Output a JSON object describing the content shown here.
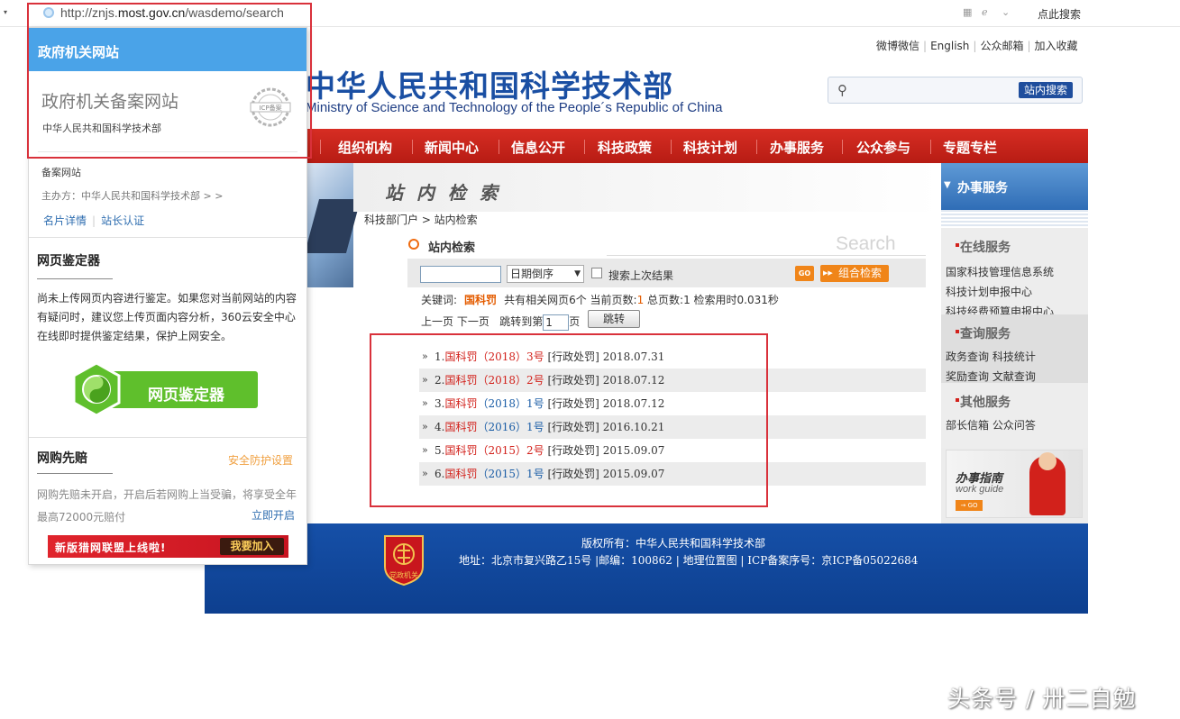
{
  "browser": {
    "url_prefix": "http://znjs.",
    "url_domain": "most.gov.cn",
    "url_path": "/wasdemo/search",
    "search_label": "点此搜索"
  },
  "site": {
    "title": "中华人民共和国科学技术部",
    "subtitle": "Ministry of Science and Technology of the People´s Republic of China",
    "top_links": [
      "微博微信",
      "English",
      "公众邮箱",
      "加入收藏"
    ],
    "search_button": "站内搜索",
    "nav": [
      "组织机构",
      "新闻中心",
      "信息公开",
      "科技政策",
      "科技计划",
      "办事服务",
      "公众参与",
      "专题专栏"
    ],
    "content_title": "站 内 检 索",
    "breadcrumb": "科技部门户 > 站内检索",
    "search_label": "站内检索",
    "search_watermark": "Search",
    "sort_option": "日期倒序",
    "last_result_label": "搜索上次结果",
    "go_label": "GO",
    "combo_label": "组合检索",
    "result_info": {
      "prefix": "关键词:",
      "keyword": "国科罚",
      "pages_text": "共有相关网页6个  当前页数:",
      "current_page": "1",
      "total_text": "总页数:1 检索用时0.031秒"
    },
    "pager": {
      "prev_next": "上一页 下一页",
      "jump_to": "跳转到第",
      "page_value": "1",
      "page_suffix": "页",
      "jump_button": "跳转"
    },
    "results": [
      {
        "num": "1.",
        "code": "国科罚",
        "year": "（2018）",
        "no": "3号",
        "tag": "[行政处罚]",
        "date": "2018.07.31"
      },
      {
        "num": "2.",
        "code": "国科罚",
        "year": "（2018）",
        "no": "2号",
        "tag": "[行政处罚]",
        "date": "2018.07.12"
      },
      {
        "num": "3.",
        "code": "国科罚",
        "year": "（2018）",
        "no": "1号",
        "tag": "[行政处罚]",
        "date": "2018.07.12"
      },
      {
        "num": "4.",
        "code": "国科罚",
        "year": "（2016）",
        "no": "1号",
        "tag": "[行政处罚]",
        "date": "2016.10.21"
      },
      {
        "num": "5.",
        "code": "国科罚",
        "year": "（2015）",
        "no": "2号",
        "tag": "[行政处罚]",
        "date": "2015.09.07"
      },
      {
        "num": "6.",
        "code": "国科罚",
        "year": "（2015）",
        "no": "1号",
        "tag": "[行政处罚]",
        "date": "2015.09.07"
      }
    ],
    "right": {
      "header": "办事服务",
      "online_title": "在线服务",
      "online_items": [
        "国家科技管理信息系统",
        "科技计划申报中心",
        "科技经费预算申报中心"
      ],
      "query_title": "查询服务",
      "query_items": [
        "政务查询 科技统计",
        "奖励查询 文献查询"
      ],
      "other_title": "其他服务",
      "other_items": [
        "部长信箱 公众问答"
      ],
      "guide_title": "办事指南",
      "guide_sub": "work guide",
      "guide_go": "→ GO"
    },
    "footer": {
      "emblem_text": "党政机关",
      "line1": "版权所有：中华人民共和国科学技术部",
      "line2": "地址：北京市复兴路乙15号 |邮编：100862 | 地理位置图 | ICP备案序号：京ICP备05022684"
    }
  },
  "popup": {
    "header": "政府机关网站",
    "icp_title": "政府机关备案网站",
    "icp_org": "中华人民共和国科学技术部",
    "seal_text": "ICP备案",
    "beian": "备案网站",
    "host": "主办方：中华人民共和国科学技术部  > >",
    "link_card": "名片详情",
    "link_cert": "站长认证",
    "checker_title": "网页鉴定器",
    "checker_desc": "尚未上传网页内容进行鉴定。如果您对当前网站的内容有疑问时，建议您上传页面内容分析，360云安全中心在线即时提供鉴定结果，保护上网安全。",
    "checker_button": "网页鉴定器",
    "shop_title": "网购先赔",
    "shop_setting": "安全防护设置",
    "shop_desc": "网购先赔未开启，开启后若网购上当受骗，将享受全年最高72000元赔付",
    "shop_open": "立即开启",
    "ad_text": "新版猎网联盟上线啦!",
    "ad_button": "我要加入"
  },
  "watermark": "头条号 / 卅二自勉"
}
